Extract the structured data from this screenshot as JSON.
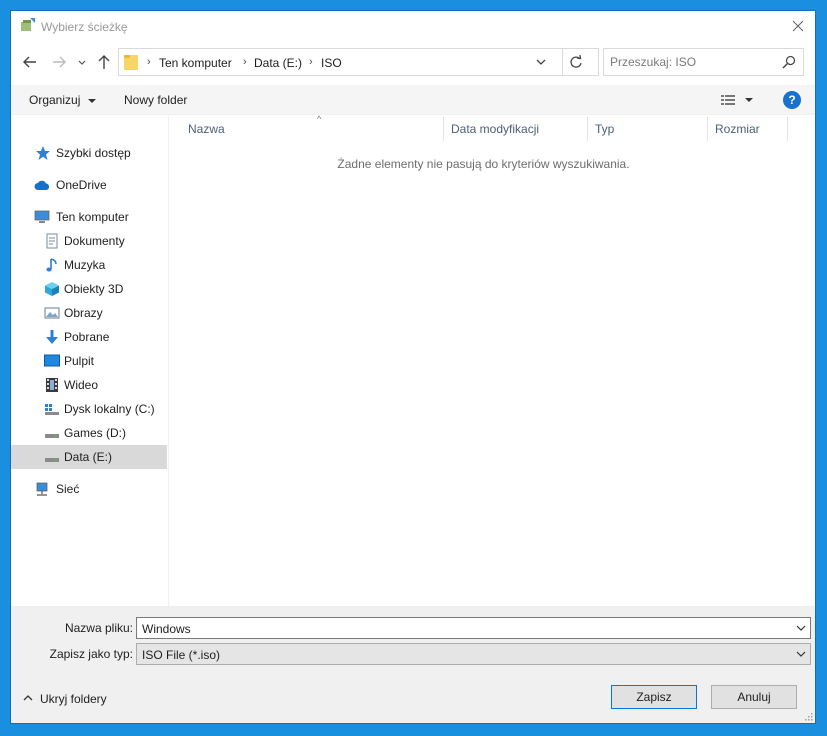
{
  "window": {
    "title": "Wybierz ścieżkę"
  },
  "address": {
    "crumbs": [
      "Ten komputer",
      "Data (E:)",
      "ISO"
    ]
  },
  "search": {
    "placeholder": "Przeszukaj: ISO"
  },
  "toolbar": {
    "organize_label": "Organizuj",
    "new_folder_label": "Nowy folder"
  },
  "sidebar": {
    "items": [
      {
        "label": "Szybki dostęp",
        "icon": "star-icon"
      },
      {
        "label": "OneDrive",
        "icon": "cloud-icon"
      },
      {
        "label": "Ten komputer",
        "icon": "computer-icon"
      },
      {
        "label": "Dokumenty",
        "icon": "document-icon"
      },
      {
        "label": "Muzyka",
        "icon": "music-icon"
      },
      {
        "label": "Obiekty 3D",
        "icon": "cube-icon"
      },
      {
        "label": "Obrazy",
        "icon": "pictures-icon"
      },
      {
        "label": "Pobrane",
        "icon": "download-icon"
      },
      {
        "label": "Pulpit",
        "icon": "desktop-icon"
      },
      {
        "label": "Wideo",
        "icon": "video-icon"
      },
      {
        "label": "Dysk lokalny (C:)",
        "icon": "system-drive-icon"
      },
      {
        "label": "Games (D:)",
        "icon": "drive-icon"
      },
      {
        "label": "Data (E:)",
        "icon": "drive-icon"
      },
      {
        "label": "Sieć",
        "icon": "network-icon"
      }
    ],
    "selected": "Data (E:)"
  },
  "columns": [
    "Nazwa",
    "Data modyfikacji",
    "Typ",
    "Rozmiar"
  ],
  "empty_message": "Żadne elementy nie pasują do kryteriów wyszukiwania.",
  "form": {
    "filename_label": "Nazwa pliku:",
    "filename_value": "Windows",
    "filetype_label": "Zapisz jako typ:",
    "filetype_value": "ISO File (*.iso)"
  },
  "footer": {
    "hide_folders_label": "Ukryj foldery",
    "save_label": "Zapisz",
    "cancel_label": "Anuluj"
  },
  "colors": {
    "accent": "#0078d7",
    "desktop": "#1a8fe0",
    "selected_row": "#d9d9d9"
  }
}
